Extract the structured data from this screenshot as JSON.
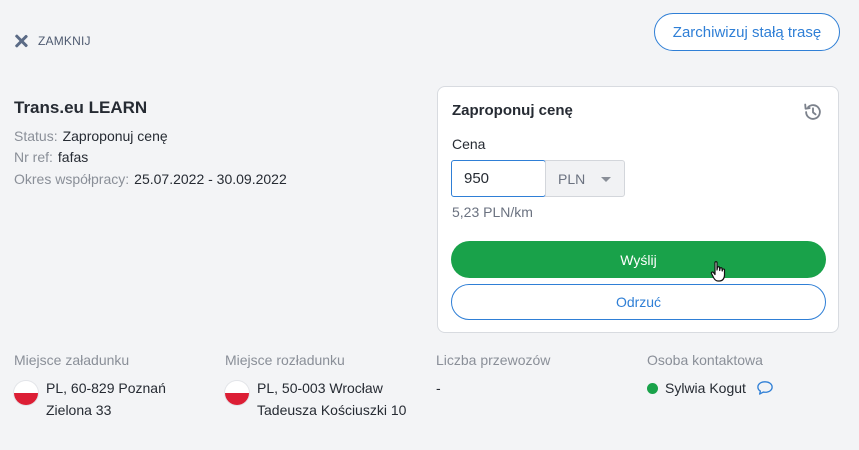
{
  "header": {
    "close_label": "ZAMKNIJ",
    "archive_label": "Zarchiwizuj stałą trasę"
  },
  "company": {
    "name": "Trans.eu LEARN",
    "status_key": "Status:",
    "status_value": "Zaproponuj cenę",
    "ref_key": "Nr ref:",
    "ref_value": "fafas",
    "period_key": "Okres współpracy:",
    "period_value": "25.07.2022 - 30.09.2022"
  },
  "offer": {
    "title": "Zaproponuj cenę",
    "price_label": "Cena",
    "price_value": "950",
    "currency": "PLN",
    "per_km": "5,23 PLN/km",
    "send_label": "Wyślij",
    "reject_label": "Odrzuć"
  },
  "details": {
    "loading": {
      "header": "Miejsce załadunku",
      "line1": "PL, 60-829 Poznań",
      "line2": "Zielona 33",
      "country_flag": "PL"
    },
    "unloading": {
      "header": "Miejsce rozładunku",
      "line1": "PL, 50-003 Wrocław",
      "line2": "Tadeusza Kościuszki 10",
      "country_flag": "PL"
    },
    "transports": {
      "header": "Liczba przewozów",
      "value": "-"
    },
    "contact": {
      "header": "Osoba kontaktowa",
      "name": "Sylwia Kogut",
      "status_color": "#19a24a"
    }
  },
  "colors": {
    "accent": "#2f7fd6",
    "primary_button": "#19a24a",
    "background": "#f3f4f6"
  },
  "icons": [
    "close-icon",
    "history-icon",
    "chevron-down-icon",
    "hand-cursor-icon",
    "poland-flag-icon",
    "chat-icon"
  ]
}
